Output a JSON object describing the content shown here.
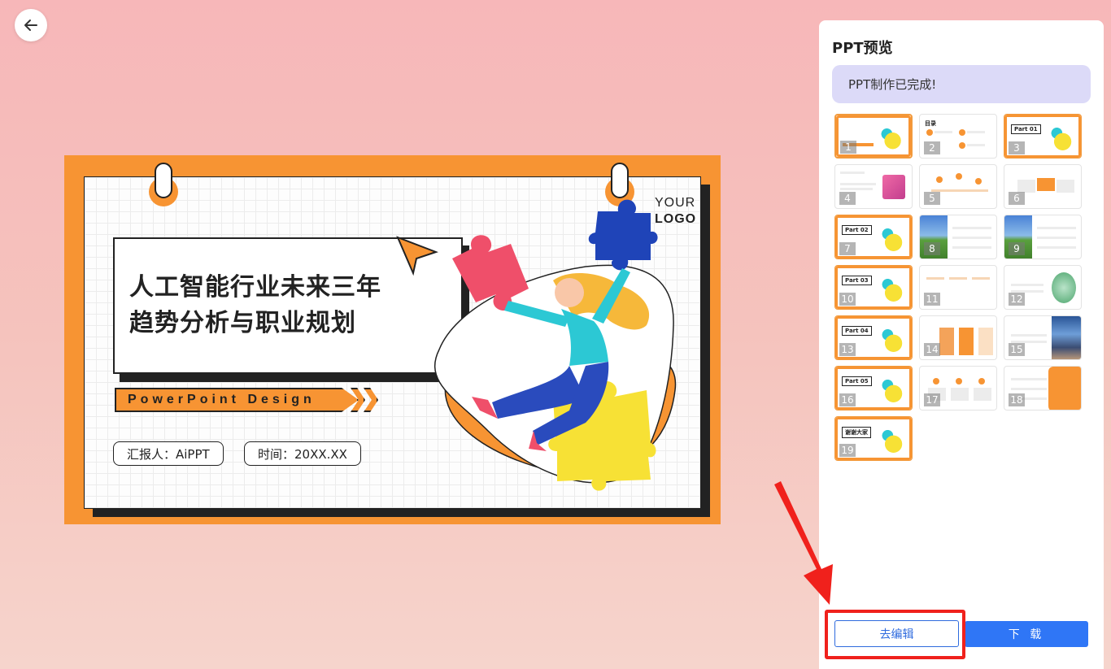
{
  "nav": {
    "back_icon": "arrow-left-icon"
  },
  "slide": {
    "logo_line1": "YOUR",
    "logo_line2": "LOGO",
    "title_line1": "人工智能行业未来三年",
    "title_line2": "趋势分析与职业规划",
    "banner": "PowerPoint Design",
    "reporter": "汇报人：AiPPT",
    "time": "时间：20XX.XX"
  },
  "panel": {
    "title": "PPT预览",
    "status": "PPT制作已完成!",
    "thumbnails": [
      {
        "n": "1",
        "label": ""
      },
      {
        "n": "2",
        "label": "目录"
      },
      {
        "n": "3",
        "label": "Part 01"
      },
      {
        "n": "4",
        "label": ""
      },
      {
        "n": "5",
        "label": ""
      },
      {
        "n": "6",
        "label": ""
      },
      {
        "n": "7",
        "label": "Part 02"
      },
      {
        "n": "8",
        "label": ""
      },
      {
        "n": "9",
        "label": ""
      },
      {
        "n": "10",
        "label": "Part 03"
      },
      {
        "n": "11",
        "label": ""
      },
      {
        "n": "12",
        "label": ""
      },
      {
        "n": "13",
        "label": "Part 04"
      },
      {
        "n": "14",
        "label": ""
      },
      {
        "n": "15",
        "label": ""
      },
      {
        "n": "16",
        "label": "Part 05"
      },
      {
        "n": "17",
        "label": ""
      },
      {
        "n": "18",
        "label": ""
      },
      {
        "n": "19",
        "label": "谢谢大家"
      }
    ],
    "edit_button": "去编辑",
    "download_button": "下 载"
  },
  "colors": {
    "accent": "#2f76f6",
    "slide_orange": "#f79433",
    "annotation_red": "#f0211c"
  }
}
